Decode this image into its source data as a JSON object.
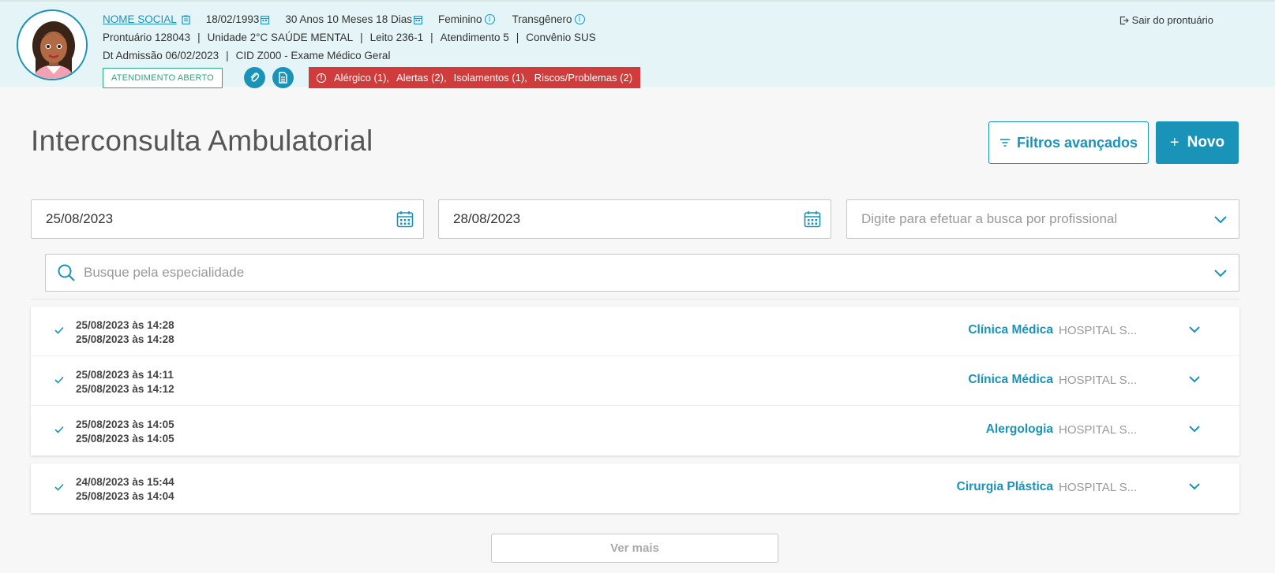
{
  "patient": {
    "social_name": "NOME SOCIAL",
    "birth_date": "18/02/1993",
    "age": "30 Anos 10 Meses 18 Dias",
    "gender": "Feminino",
    "gender_identity": "Transgênero",
    "record": "Prontuário 128043",
    "unit": "Unidade 2°C SAÚDE MENTAL",
    "bed": "Leito 236-1",
    "attendance": "Atendimento 5",
    "insurance": "Convênio SUS",
    "admission": "Dt Admissão 06/02/2023",
    "cid": "CID Z000 - Exame Médico Geral",
    "status_badge": "ATENDIMENTO ABERTO",
    "alerts": [
      "Alérgico (1),",
      "Alertas (2),",
      "Isolamentos (1),",
      "Riscos/Problemas (2)"
    ],
    "exit_label": "Sair do prontuário",
    "separator": "|"
  },
  "page": {
    "title": "Interconsulta Ambulatorial",
    "filters_button": "Filtros avançados",
    "new_button": "Novo",
    "new_plus": "+"
  },
  "filters": {
    "start_date": "25/08/2023",
    "end_date": "28/08/2023",
    "professional_placeholder": "Digite para efetuar a busca por profissional",
    "specialty_placeholder": "Busque pela especialidade"
  },
  "results": [
    {
      "date1": "25/08/2023 às 14:28",
      "date2": "25/08/2023 às 14:28",
      "specialty": "Clínica Médica",
      "hospital": "HOSPITAL S..."
    },
    {
      "date1": "25/08/2023 às 14:11",
      "date2": "25/08/2023 às 14:12",
      "specialty": "Clínica Médica",
      "hospital": "HOSPITAL S..."
    },
    {
      "date1": "25/08/2023 às 14:05",
      "date2": "25/08/2023 às 14:05",
      "specialty": "Alergologia",
      "hospital": "HOSPITAL S..."
    },
    {
      "date1": "24/08/2023 às 15:44",
      "date2": "25/08/2023 às 14:04",
      "specialty": "Cirurgia Plástica",
      "hospital": "HOSPITAL S..."
    }
  ],
  "more_button": "Ver mais",
  "colors": {
    "accent": "#1a93b8",
    "header_bg": "#e5f5f7",
    "alert_bg": "#d03c3c",
    "badge_green": "#2aa77a"
  }
}
